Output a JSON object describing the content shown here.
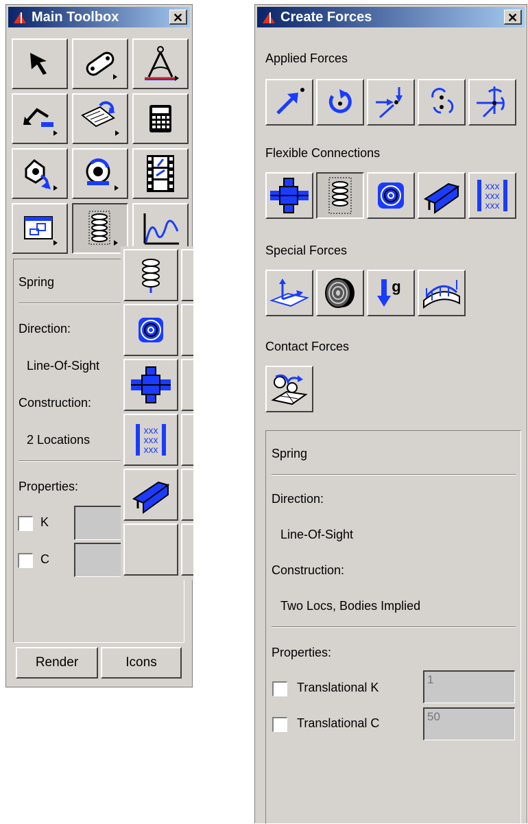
{
  "main_toolbox": {
    "title": "Main Toolbox",
    "close_glyph": "✕",
    "tools": [
      {
        "icon": "select-arrow-icon"
      },
      {
        "icon": "link-part-icon"
      },
      {
        "icon": "measure-compass-icon"
      },
      {
        "icon": "undo-icon"
      },
      {
        "icon": "hinge-joint-icon"
      },
      {
        "icon": "calculator-icon"
      },
      {
        "icon": "torque-motion-icon"
      },
      {
        "icon": "body-motion-icon"
      },
      {
        "icon": "film-animation-icon"
      },
      {
        "icon": "window-view-icon"
      },
      {
        "icon": "spring-icon"
      },
      {
        "icon": "plot-icon"
      }
    ],
    "flyout_icons": [
      "spring-icon",
      "torsion-spring-icon",
      "bushing-icon",
      "field-icon",
      "beam-icon",
      "empty"
    ],
    "settings": {
      "type": "Spring",
      "direction_label": "Direction:",
      "direction_value": "Line-Of-Sight",
      "construction_label": "Construction:",
      "construction_value": "2 Locations",
      "properties_label": "Properties:",
      "prop_k": "K",
      "prop_c": "C"
    },
    "buttons": {
      "render": "Render",
      "icons": "Icons"
    }
  },
  "create_forces": {
    "title": "Create Forces",
    "close_glyph": "✕",
    "sections": {
      "applied": "Applied Forces",
      "flexible": "Flexible Connections",
      "special": "Special Forces",
      "contact": "Contact Forces"
    },
    "applied_icons": [
      "single-force-icon",
      "single-torque-icon",
      "general-force-icon",
      "multi-torque-icon",
      "six-component-force-icon"
    ],
    "flexible_icons": [
      "bushing-icon",
      "spring-icon",
      "torsion-spring-icon",
      "beam-icon",
      "field-icon"
    ],
    "special_icons": [
      "modal-force-icon",
      "tire-icon",
      "gravity-icon",
      "flexible-body-force-icon"
    ],
    "contact_icons": [
      "contact-icon"
    ],
    "gravity_letter": "g",
    "settings": {
      "type": "Spring",
      "direction_label": "Direction:",
      "direction_value": "Line-Of-Sight",
      "construction_label": "Construction:",
      "construction_value": "Two Locs, Bodies Implied",
      "properties_label": "Properties:",
      "prop_k_label": "Translational K",
      "prop_k_value": "1",
      "prop_c_label": "Translational C",
      "prop_c_value": "50"
    }
  },
  "colors": {
    "accent_blue": "#1a3cff",
    "title_start": "#0a246a",
    "title_end": "#a6caf0",
    "panel": "#d6d3ce"
  }
}
